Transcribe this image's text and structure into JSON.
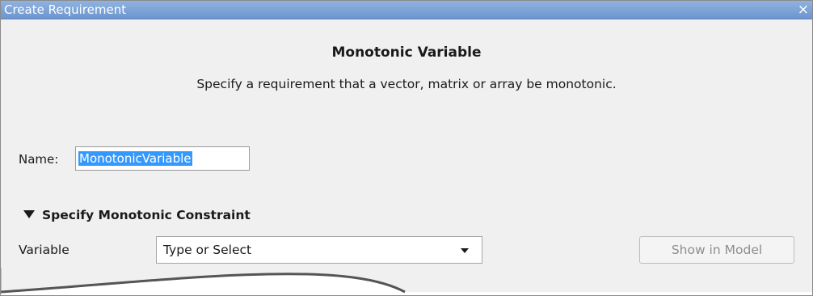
{
  "window": {
    "title": "Create Requirement",
    "close_glyph": "×"
  },
  "header": {
    "title": "Monotonic Variable",
    "description": "Specify a requirement that a vector, matrix or array be monotonic."
  },
  "name_field": {
    "label": "Name:",
    "value": "MonotonicVariable",
    "selected": true
  },
  "section": {
    "title": "Specify Monotonic Constraint",
    "expanded": true,
    "icon": "triangle-down-icon"
  },
  "variable": {
    "label": "Variable",
    "selected_value": "Type or Select",
    "icon": "dropdown-arrow-icon"
  },
  "buttons": {
    "show_in_model": "Show in Model",
    "show_in_model_enabled": false
  },
  "colors": {
    "titlebar": "#7aa1d6",
    "selection": "#3399ff",
    "background": "#f0f0f0"
  }
}
